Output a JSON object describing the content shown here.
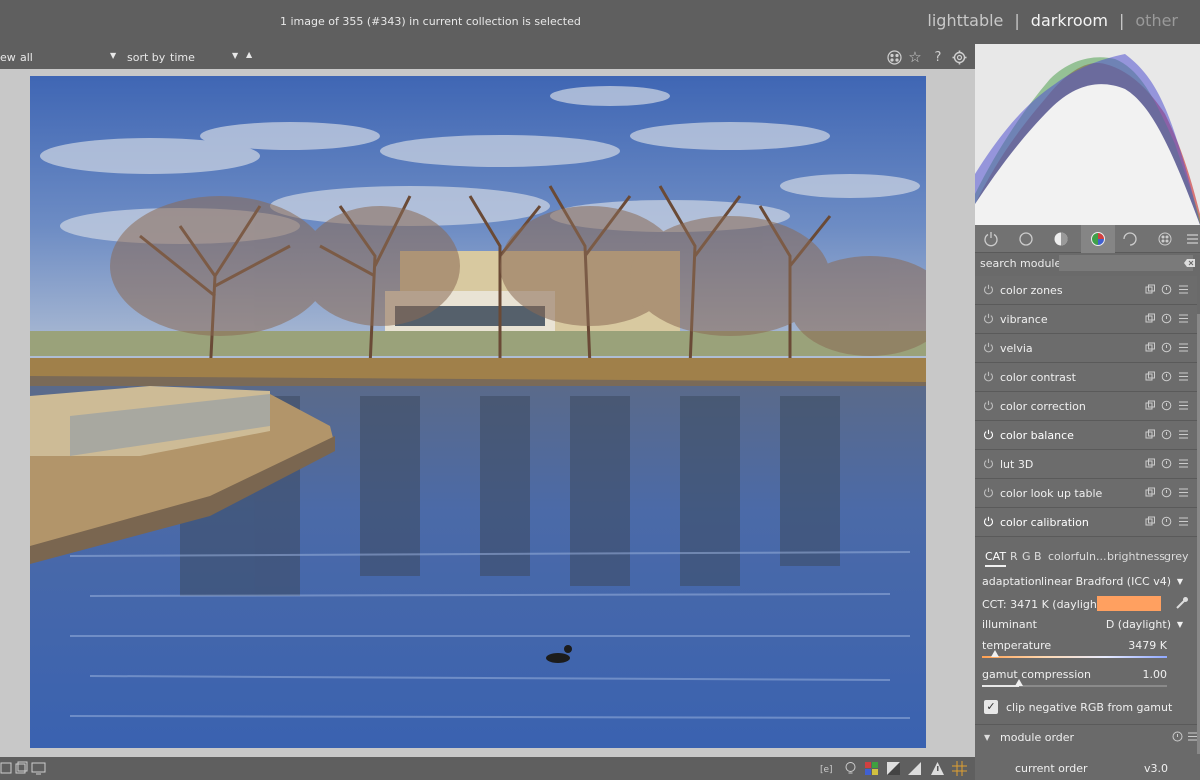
{
  "header": {
    "status": "1 image of 355 (#343) in current collection is selected",
    "views": {
      "lighttable": "lighttable",
      "sep1": "|",
      "darkroom": "darkroom",
      "sep2": "|",
      "other": "other"
    }
  },
  "filterbar": {
    "view_label": "ew",
    "view_value": "all",
    "sort_label": "sort by",
    "sort_value": "time"
  },
  "panel": {
    "search_label": "search module",
    "search_placeholder": "",
    "modules": [
      {
        "name": "color zones",
        "on": false
      },
      {
        "name": "vibrance",
        "on": false
      },
      {
        "name": "velvia",
        "on": false
      },
      {
        "name": "color contrast",
        "on": false
      },
      {
        "name": "color correction",
        "on": false
      },
      {
        "name": "color balance",
        "on": true
      },
      {
        "name": "lut 3D",
        "on": false
      },
      {
        "name": "color look up table",
        "on": false
      },
      {
        "name": "color calibration",
        "on": true
      }
    ],
    "calibration": {
      "tabs": [
        "CAT",
        "R",
        "G",
        "B",
        "colorfuln...",
        "brightness",
        "grey"
      ],
      "adaptation_label": "adaptation",
      "adaptation_value": "linear Bradford (ICC v4)",
      "cct_text": "CCT: 3471 K (daylight)",
      "cct_swatch_color": "#ffa060",
      "illuminant_label": "illuminant",
      "illuminant_value": "D (daylight)",
      "temperature_label": "temperature",
      "temperature_value": "3479 K",
      "temperature_fraction": 0.07,
      "gamut_label": "gamut compression",
      "gamut_value": "1.00",
      "gamut_fraction": 0.2,
      "clip_label": "clip negative RGB from gamut",
      "clip_checked": true
    },
    "module_order": {
      "title": "module order",
      "current_label": "current order",
      "current_value": "v3.0"
    }
  },
  "colors": {
    "accent": "#ffa060",
    "panel": "#6a6a6a",
    "canvas": "#c8c8c8"
  }
}
